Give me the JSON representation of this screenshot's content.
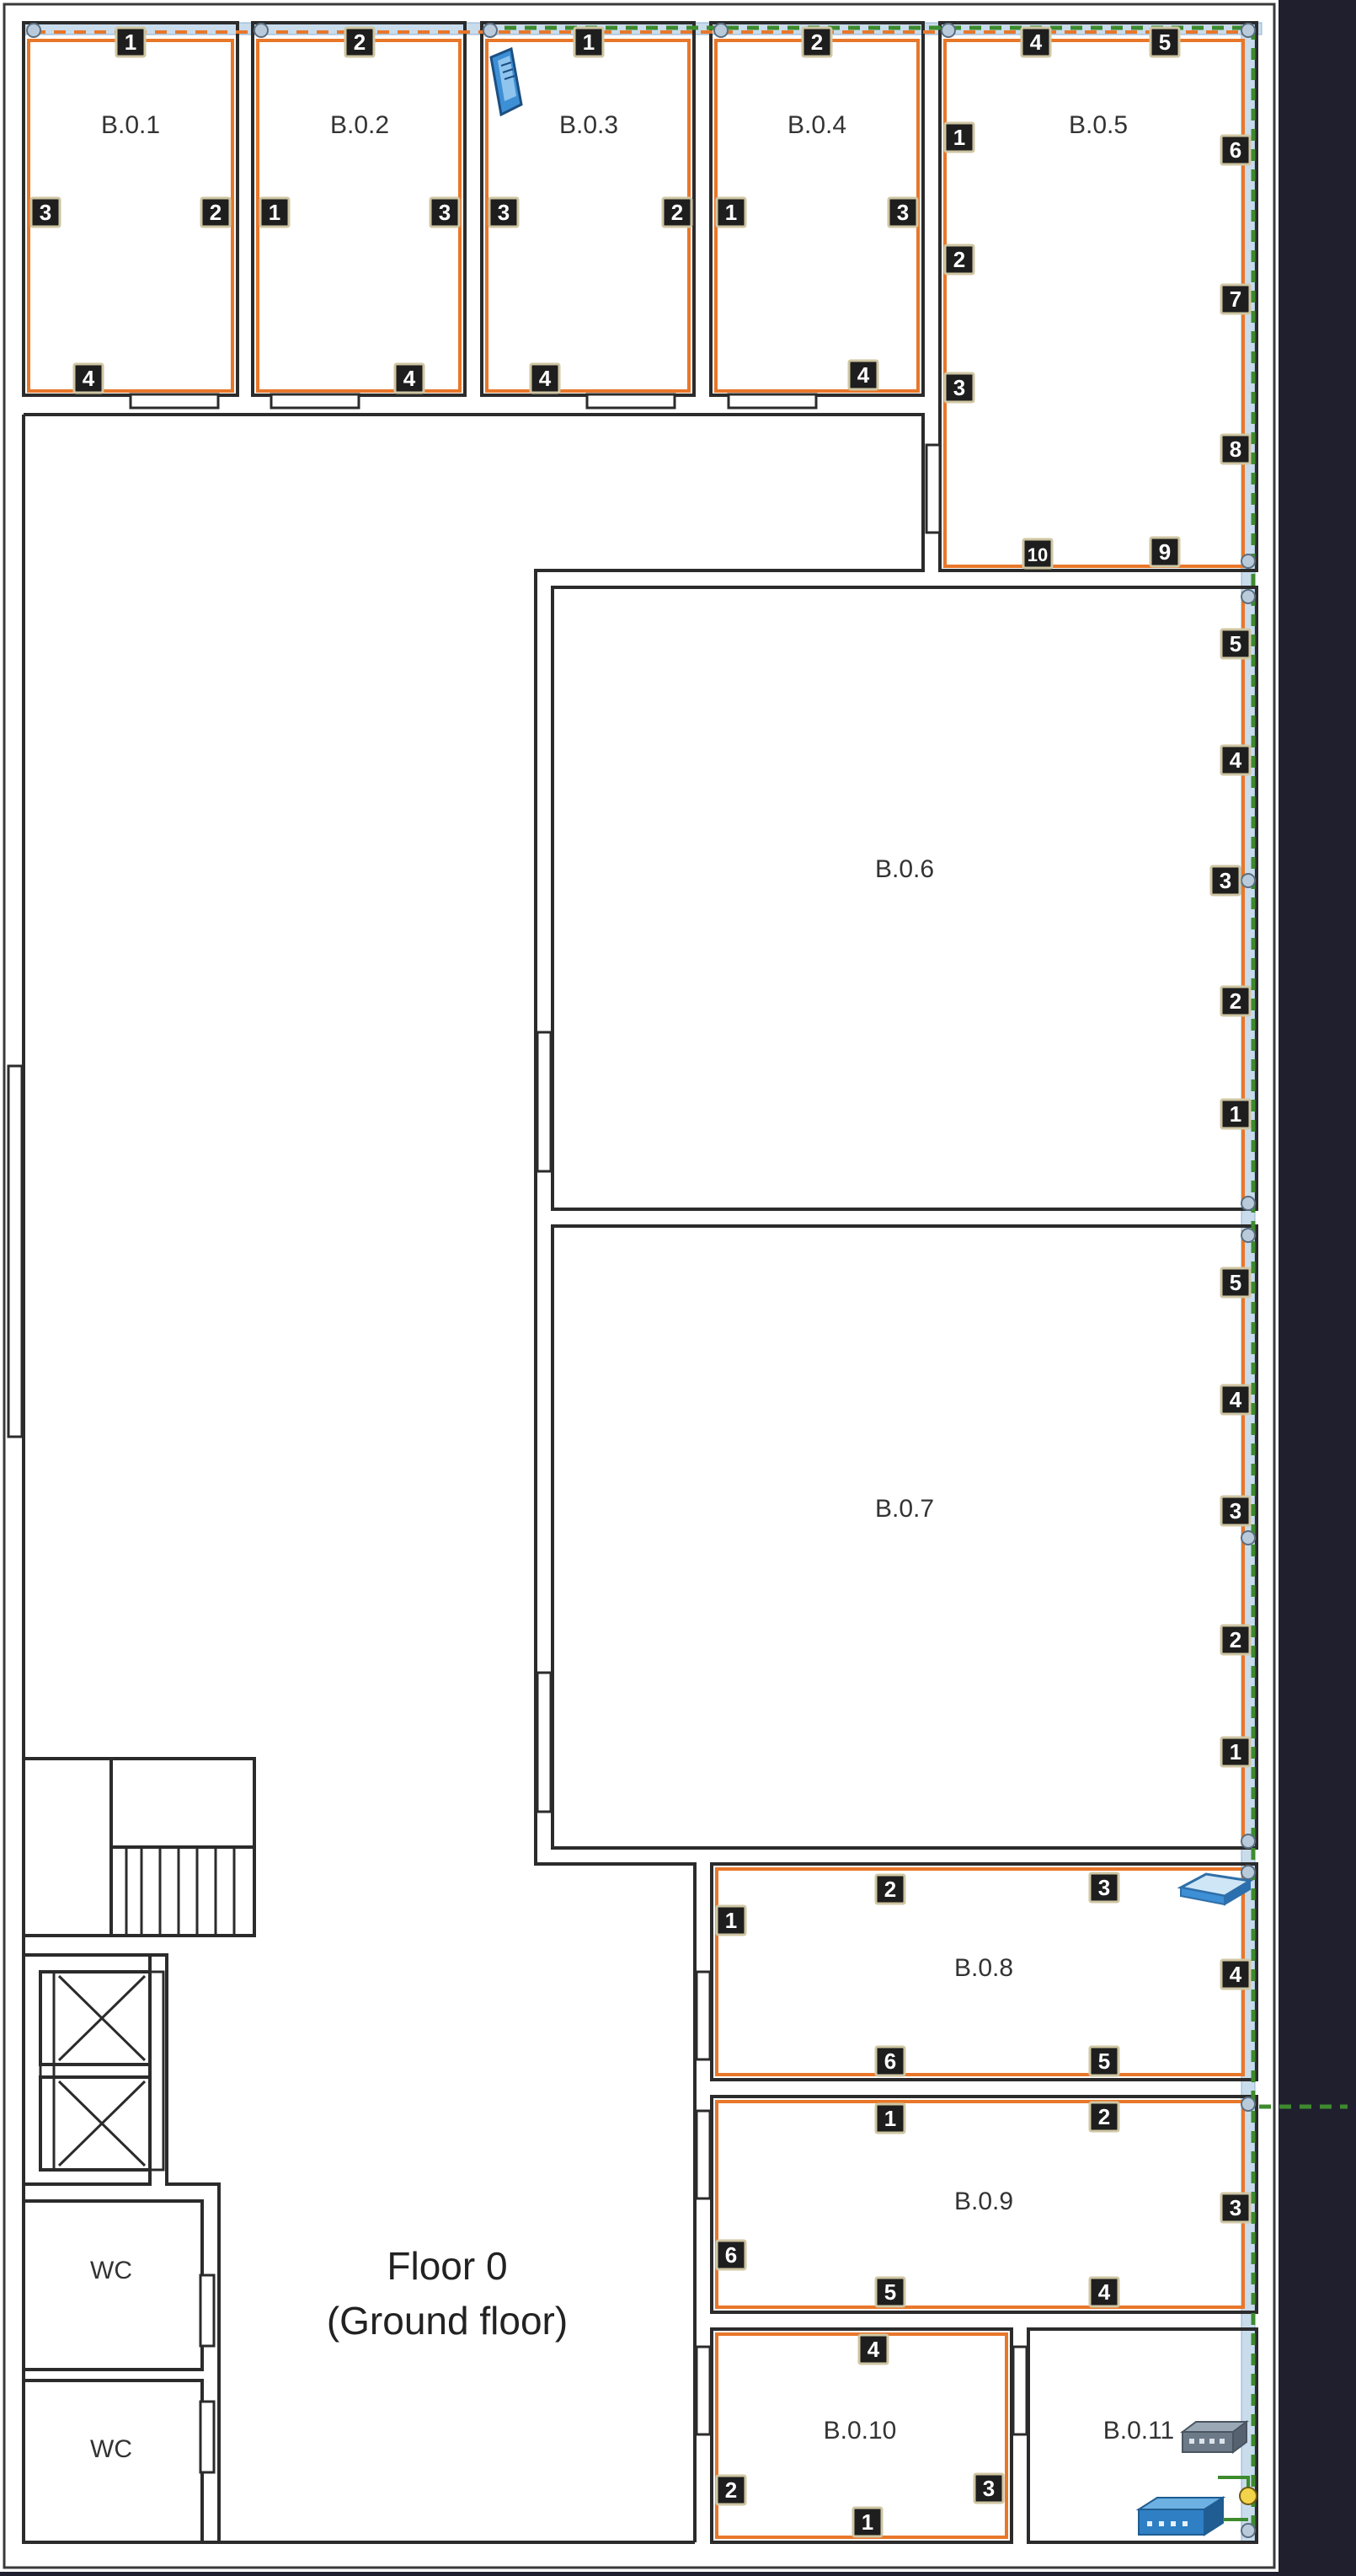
{
  "floor": {
    "title": "Floor 0",
    "subtitle": "(Ground floor)"
  },
  "rooms": [
    {
      "id": "r1",
      "label": "B.0.1"
    },
    {
      "id": "r2",
      "label": "B.0.2"
    },
    {
      "id": "r3",
      "label": "B.0.3"
    },
    {
      "id": "r4",
      "label": "B.0.4"
    },
    {
      "id": "r5",
      "label": "B.0.5"
    },
    {
      "id": "r6",
      "label": "B.0.6"
    },
    {
      "id": "r7",
      "label": "B.0.7"
    },
    {
      "id": "r8",
      "label": "B.0.8"
    },
    {
      "id": "r9",
      "label": "B.0.9"
    },
    {
      "id": "r10",
      "label": "B.0.10"
    },
    {
      "id": "r11",
      "label": "B.0.11"
    }
  ],
  "restrooms": [
    {
      "id": "wc1",
      "label": "WC"
    },
    {
      "id": "wc2",
      "label": "WC"
    }
  ],
  "outlets": [
    {
      "room": "B.0.1",
      "n": "1"
    },
    {
      "room": "B.0.1",
      "n": "2"
    },
    {
      "room": "B.0.1",
      "n": "3"
    },
    {
      "room": "B.0.1",
      "n": "4"
    },
    {
      "room": "B.0.2",
      "n": "2"
    },
    {
      "room": "B.0.2",
      "n": "1"
    },
    {
      "room": "B.0.2",
      "n": "3"
    },
    {
      "room": "B.0.2",
      "n": "4"
    },
    {
      "room": "B.0.3",
      "n": "1"
    },
    {
      "room": "B.0.3",
      "n": "3"
    },
    {
      "room": "B.0.3",
      "n": "2"
    },
    {
      "room": "B.0.3",
      "n": "4"
    },
    {
      "room": "B.0.4",
      "n": "2"
    },
    {
      "room": "B.0.4",
      "n": "1"
    },
    {
      "room": "B.0.4",
      "n": "3"
    },
    {
      "room": "B.0.4",
      "n": "4"
    },
    {
      "room": "B.0.5",
      "n": "4"
    },
    {
      "room": "B.0.5",
      "n": "5"
    },
    {
      "room": "B.0.5",
      "n": "1"
    },
    {
      "room": "B.0.5",
      "n": "6"
    },
    {
      "room": "B.0.5",
      "n": "2"
    },
    {
      "room": "B.0.5",
      "n": "7"
    },
    {
      "room": "B.0.5",
      "n": "3"
    },
    {
      "room": "B.0.5",
      "n": "8"
    },
    {
      "room": "B.0.5",
      "n": "10"
    },
    {
      "room": "B.0.5",
      "n": "9"
    },
    {
      "room": "B.0.6",
      "n": "5"
    },
    {
      "room": "B.0.6",
      "n": "4"
    },
    {
      "room": "B.0.6",
      "n": "3"
    },
    {
      "room": "B.0.6",
      "n": "2"
    },
    {
      "room": "B.0.6",
      "n": "1"
    },
    {
      "room": "B.0.7",
      "n": "5"
    },
    {
      "room": "B.0.7",
      "n": "4"
    },
    {
      "room": "B.0.7",
      "n": "3"
    },
    {
      "room": "B.0.7",
      "n": "2"
    },
    {
      "room": "B.0.7",
      "n": "1"
    },
    {
      "room": "B.0.8",
      "n": "2"
    },
    {
      "room": "B.0.8",
      "n": "3"
    },
    {
      "room": "B.0.8",
      "n": "1"
    },
    {
      "room": "B.0.8",
      "n": "4"
    },
    {
      "room": "B.0.8",
      "n": "6"
    },
    {
      "room": "B.0.8",
      "n": "5"
    },
    {
      "room": "B.0.9",
      "n": "1"
    },
    {
      "room": "B.0.9",
      "n": "2"
    },
    {
      "room": "B.0.9",
      "n": "3"
    },
    {
      "room": "B.0.9",
      "n": "6"
    },
    {
      "room": "B.0.9",
      "n": "5"
    },
    {
      "room": "B.0.9",
      "n": "4"
    },
    {
      "room": "B.0.10",
      "n": "4"
    },
    {
      "room": "B.0.10",
      "n": "2"
    },
    {
      "room": "B.0.10",
      "n": "3"
    },
    {
      "room": "B.0.10",
      "n": "1"
    }
  ],
  "devices": [
    {
      "id": "ap1",
      "icon": "access-point-icon"
    },
    {
      "id": "ap2",
      "icon": "access-point-icon"
    },
    {
      "id": "sw1",
      "icon": "switch-icon"
    },
    {
      "id": "rt1",
      "icon": "router-icon"
    }
  ],
  "colors": {
    "wall": "#2b2b2b",
    "outer_frame": "#3a3a3a",
    "electrical": "#e8772a",
    "network": "#3d8b2e",
    "port_badge": "#1e1e1e",
    "background": "#1f1f2e",
    "conduit": "#a8c6e0"
  }
}
